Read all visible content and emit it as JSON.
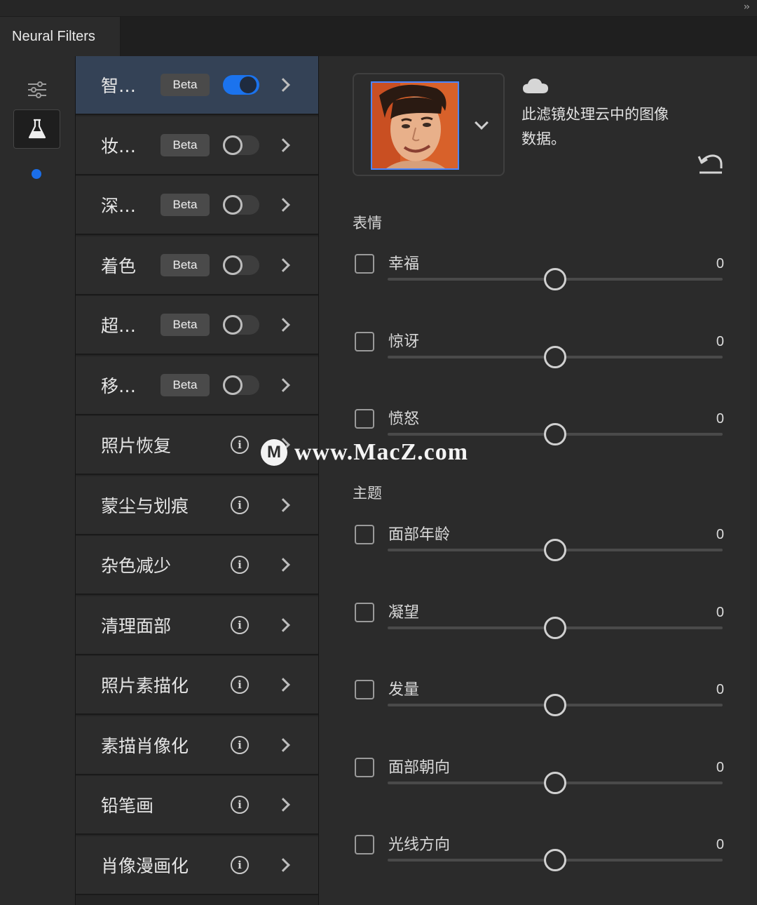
{
  "window": {
    "tab_title": "Neural Filters",
    "collapse_glyph": "››"
  },
  "rail": {
    "items": [
      {
        "icon": "sliders-icon",
        "active": false
      },
      {
        "icon": "flask-icon",
        "active": true
      }
    ],
    "indicator_color": "#1b6ee8"
  },
  "filters": [
    {
      "label": "智…",
      "badge": "Beta",
      "control": "toggle",
      "on": true,
      "selected": true
    },
    {
      "label": "妆…",
      "badge": "Beta",
      "control": "toggle",
      "on": false
    },
    {
      "label": "深…",
      "badge": "Beta",
      "control": "toggle",
      "on": false
    },
    {
      "label": "着色",
      "badge": "Beta",
      "control": "toggle",
      "on": false
    },
    {
      "label": "超…",
      "badge": "Beta",
      "control": "toggle",
      "on": false
    },
    {
      "label": "移…",
      "badge": "Beta",
      "control": "toggle",
      "on": false
    },
    {
      "label": "照片恢复",
      "control": "info"
    },
    {
      "label": "蒙尘与划痕",
      "control": "info"
    },
    {
      "label": "杂色减少",
      "control": "info"
    },
    {
      "label": "清理面部",
      "control": "info"
    },
    {
      "label": "照片素描化",
      "control": "info"
    },
    {
      "label": "素描肖像化",
      "control": "info"
    },
    {
      "label": "铅笔画",
      "control": "info"
    },
    {
      "label": "肖像漫画化",
      "control": "info"
    }
  ],
  "panel": {
    "cloud_text": "此滤镜处理云中的图像数据。",
    "sections": [
      {
        "title": "表情",
        "sliders": [
          {
            "label": "幸福",
            "value": "0"
          },
          {
            "label": "惊讶",
            "value": "0"
          },
          {
            "label": "愤怒",
            "value": "0"
          }
        ]
      },
      {
        "title": "主题",
        "sliders": [
          {
            "label": "面部年龄",
            "value": "0"
          },
          {
            "label": "凝望",
            "value": "0"
          },
          {
            "label": "发量",
            "value": "0"
          },
          {
            "label": "面部朝向",
            "value": "0"
          },
          {
            "label": "光线方向",
            "value": "0"
          }
        ]
      }
    ]
  },
  "watermark": {
    "logo": "M",
    "text": "www.MacZ.com"
  },
  "colors": {
    "accent": "#1b73ee",
    "selected_row": "#344256"
  }
}
